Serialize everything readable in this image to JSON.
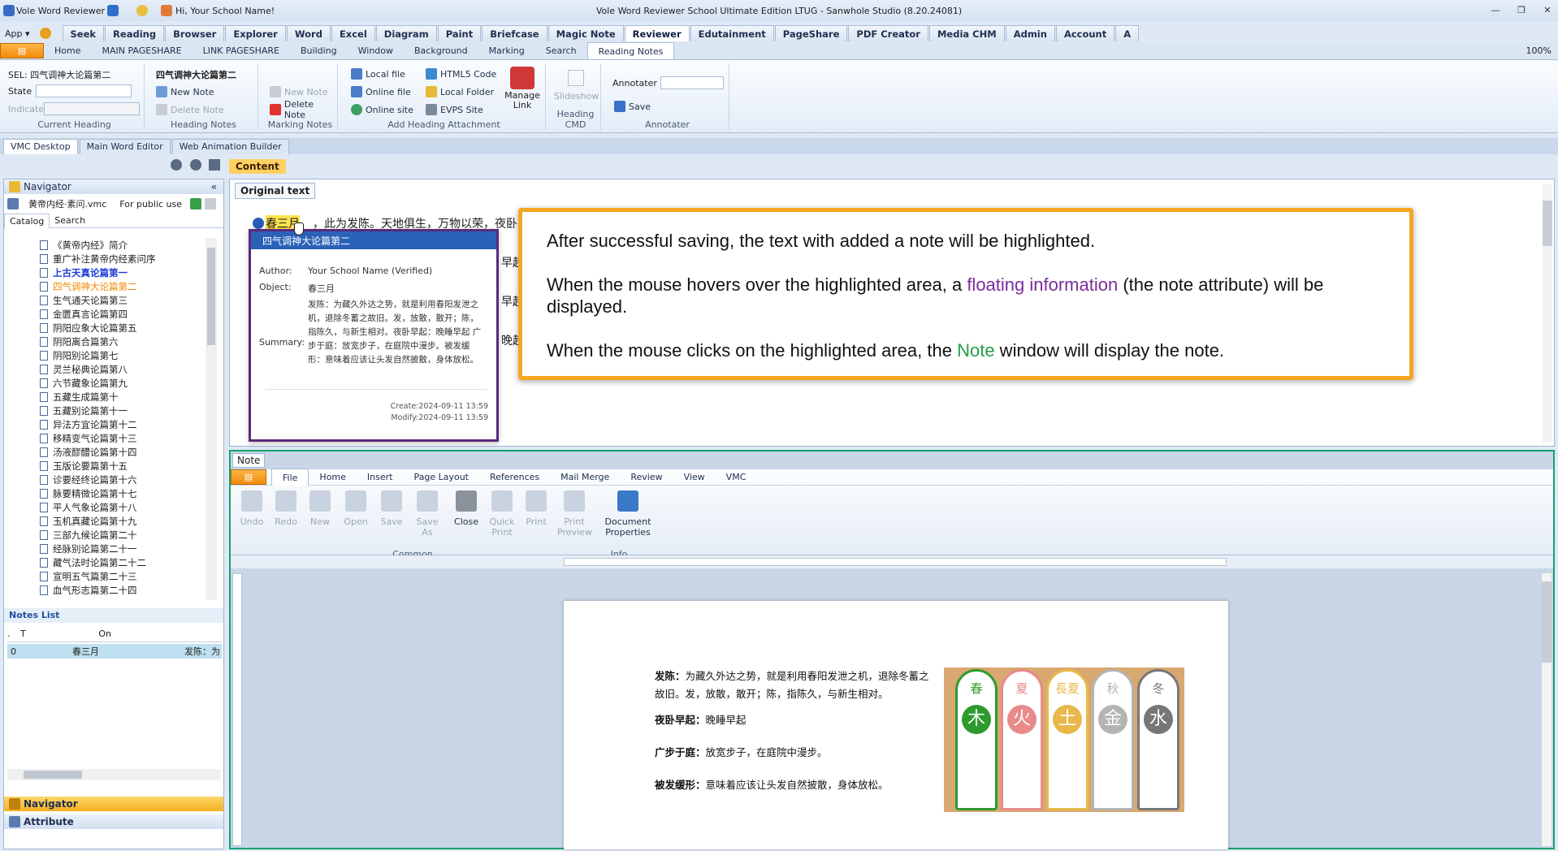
{
  "titlebar": {
    "app_name": "Vole Word Reviewer",
    "greeting": "Hi, Your School Name!",
    "title": "Vole Word Reviewer School Ultimate Edition LTUG - Sanwhole Studio (8.20.24081)"
  },
  "main_tabs": [
    "App ▾",
    "Seek",
    "Reading",
    "Browser",
    "Explorer",
    "Word",
    "Excel",
    "Diagram",
    "Paint",
    "Briefcase",
    "Magic Note",
    "Reviewer",
    "Edutainment",
    "PageShare",
    "PDF Creator",
    "Media CHM",
    "Admin",
    "Account",
    "A"
  ],
  "active_main_tab": "Reviewer",
  "sub_tabs": [
    "Home",
    "MAIN PAGESHARE",
    "LINK PAGESHARE",
    "Building",
    "Window",
    "Background",
    "Marking",
    "Search",
    "Reading Notes"
  ],
  "active_sub_tab": "Reading Notes",
  "zoom": "100%",
  "ribbon": {
    "current_heading": {
      "sel_label": "SEL: 四气调神大论篇第二",
      "state_label": "State",
      "indicate_label": "Indicate",
      "group_label": "Current Heading"
    },
    "heading_notes": {
      "title": "四气调神大论篇第二",
      "new_note": "New Note",
      "delete_note": "Delete Note",
      "group_label": "Heading Notes"
    },
    "marking_notes": {
      "new_note": "New Note",
      "delete_note": "Delete Note",
      "group_label": "Marking Notes"
    },
    "attachment": {
      "local_file": "Local file",
      "online_file": "Online file",
      "online_site": "Online site",
      "html5_code": "HTML5 Code",
      "local_folder": "Local Folder",
      "evps_site": "EVPS Site",
      "manage_link": "Manage Link",
      "group_label": "Add Heading Attachment"
    },
    "heading_cmd": {
      "slideshow": "Slideshow",
      "group_label": "Heading CMD"
    },
    "annotater": {
      "label": "Annotater",
      "save": "Save",
      "group_label": "Annotater"
    }
  },
  "doc_tabs": [
    "VMC Desktop",
    "Main Word Editor",
    "Web Animation Builder"
  ],
  "navigator": {
    "title": "Navigator",
    "file": "黄帝内经·素问.vmc",
    "public": "For public use",
    "tabs": [
      "Catalog",
      "Search"
    ],
    "items": [
      {
        "label": "《黄帝内经》简介",
        "style": ""
      },
      {
        "label": "重广补注黄帝内经素问序",
        "style": ""
      },
      {
        "label": "上古天真论篇第一",
        "style": "blue"
      },
      {
        "label": "四气调神大论篇第二",
        "style": "orange"
      },
      {
        "label": "生气通天论篇第三",
        "style": ""
      },
      {
        "label": "金匮真言论篇第四",
        "style": ""
      },
      {
        "label": "阴阳应象大论篇第五",
        "style": ""
      },
      {
        "label": "阴阳离合篇第六",
        "style": ""
      },
      {
        "label": "阴阳别论篇第七",
        "style": ""
      },
      {
        "label": "灵兰秘典论篇第八",
        "style": ""
      },
      {
        "label": "六节藏象论篇第九",
        "style": ""
      },
      {
        "label": "五藏生成篇第十",
        "style": ""
      },
      {
        "label": "五藏别论篇第十一",
        "style": ""
      },
      {
        "label": "异法方宜论篇第十二",
        "style": ""
      },
      {
        "label": "移精变气论篇第十三",
        "style": ""
      },
      {
        "label": "汤液醪醴论篇第十四",
        "style": ""
      },
      {
        "label": "玉版论要篇第十五",
        "style": ""
      },
      {
        "label": "诊要经终论篇第十六",
        "style": ""
      },
      {
        "label": "脉要精微论篇第十七",
        "style": ""
      },
      {
        "label": "平人气象论篇第十八",
        "style": ""
      },
      {
        "label": "玉机真藏论篇第十九",
        "style": ""
      },
      {
        "label": "三部九候论篇第二十",
        "style": ""
      },
      {
        "label": "经脉别论篇第二十一",
        "style": ""
      },
      {
        "label": "藏气法时论篇第二十二",
        "style": ""
      },
      {
        "label": "宣明五气篇第二十三",
        "style": ""
      },
      {
        "label": "血气形志篇第二十四",
        "style": ""
      }
    ],
    "notes_list": {
      "title": "Notes List",
      "columns": [
        ".",
        "T",
        "",
        "On",
        ""
      ],
      "row": {
        "index": "0",
        "on": "春三月",
        "summary": "发陈：为"
      }
    },
    "bottom_tabs": [
      "Navigator",
      "Attribute"
    ]
  },
  "content": {
    "tab": "Content",
    "subtab": "Original text",
    "highlight": "春三月",
    "line_text": "，此为发陈。天地俱生，万物以荣，夜卧",
    "side_fragments": [
      "早起",
      "早起",
      "晚起"
    ]
  },
  "hovercard": {
    "title": "四气调神大论篇第二",
    "author_label": "Author:",
    "author": "Your School Name (Verified)",
    "object_label": "Object:",
    "object": "春三月",
    "summary_label": "Summary:",
    "summary": "发陈：为藏久外达之势，就是利用春阳发泄之机，退除冬蓄之故旧。发，放散，散开；陈，指陈久，与新生相对。夜卧早起：晚睡早起 广步于庭：放宽步子，在庭院中漫步。被发缓形：意味着应该让头发自然披散，身体放松。",
    "create": "Create:2024-09-11 13:59",
    "modify": "Modify:2024-09-11 13:59"
  },
  "callout": {
    "line1": "After successful saving, the text with added a note will be highlighted.",
    "line2_a": "When the mouse hovers over the highlighted area, a ",
    "line2_hl": "floating information",
    "line2_b": " (the note attribute) will be displayed.",
    "line3_a": "When the mouse clicks on the highlighted area, the ",
    "line3_hl": "Note",
    "line3_b": " window will display the note."
  },
  "note": {
    "title": "Note",
    "tabs": [
      "File",
      "Home",
      "Insert",
      "Page Layout",
      "References",
      "Mail Merge",
      "Review",
      "View",
      "VMC"
    ],
    "active_tab": "File",
    "buttons": [
      "Undo",
      "Redo",
      "New",
      "Open",
      "Save",
      "Save As",
      "Close",
      "Quick Print",
      "Print",
      "Print Preview",
      "Document Properties"
    ],
    "groups": [
      "Common",
      "Info"
    ],
    "page": [
      {
        "k": "发陈：",
        "v": "为藏久外达之势，就是利用春阳发泄之机，退除冬蓄之故旧。发，放散，散开；陈，指陈久，与新生相对。"
      },
      {
        "k": "夜卧早起：",
        "v": "晚睡早起"
      },
      {
        "k": "广步于庭：",
        "v": "放宽步子，在庭院中漫步。"
      },
      {
        "k": "被发缓形：",
        "v": "意味着应该让头发自然披散，身体放松。"
      }
    ],
    "seasons": [
      {
        "top": "春",
        "mid": "木",
        "color": "#2e9a2e"
      },
      {
        "top": "夏",
        "mid": "火",
        "color": "#e88a8a"
      },
      {
        "top": "長夏",
        "mid": "土",
        "color": "#e8b84a"
      },
      {
        "top": "秋",
        "mid": "金",
        "color": "#b4b4b4"
      },
      {
        "top": "冬",
        "mid": "水",
        "color": "#777777"
      }
    ]
  }
}
